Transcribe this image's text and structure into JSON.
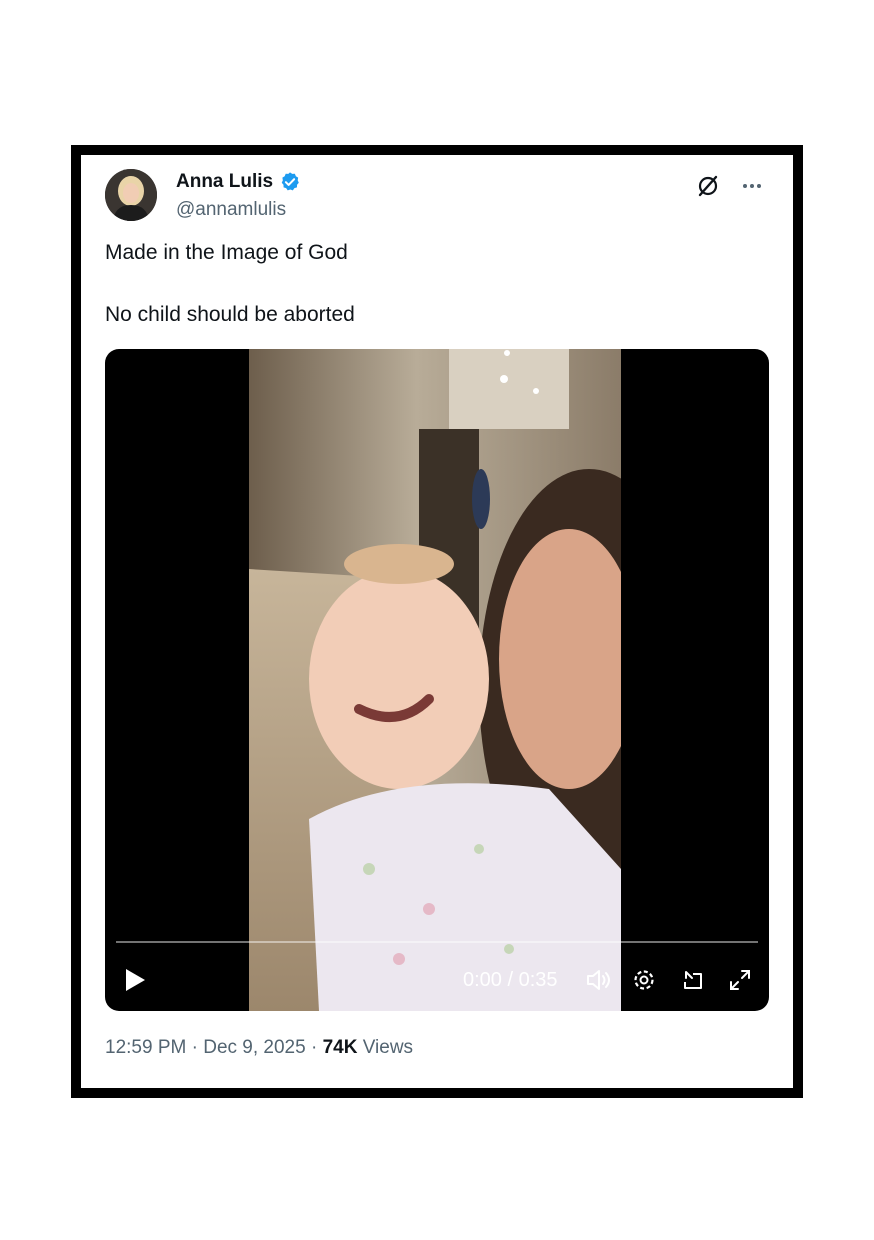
{
  "post": {
    "author_name": "Anna Lulis",
    "author_handle": "@annamlulis",
    "verified_icon": "verified-badge-icon",
    "line1": "Made in the Image of God",
    "line2": "No child should be aborted",
    "time": "12:59 PM",
    "separator1": "·",
    "date": "Dec 9, 2025",
    "separator2": "·",
    "views_count": "74K",
    "views_label": "Views"
  },
  "video": {
    "time_display": "0:00 / 0:35",
    "progress": 0,
    "icons": [
      "play-icon",
      "volume-icon",
      "settings-icon",
      "pip-icon",
      "fullscreen-icon"
    ]
  },
  "colors": {
    "accent": "#1d9bf0",
    "secondary_text": "#536471",
    "primary_text": "#0f1419"
  }
}
